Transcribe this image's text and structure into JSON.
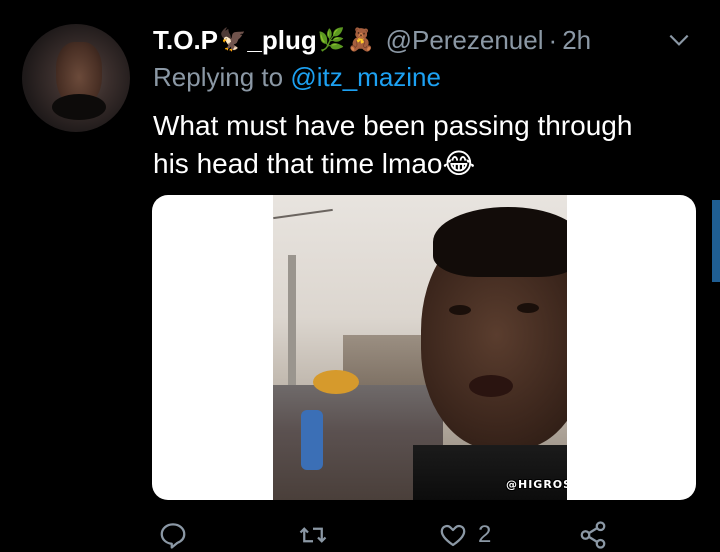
{
  "tweet": {
    "display_name": "T.O.P",
    "display_name_suffix": "_plug",
    "name_emojis": [
      "🦅",
      "🌿",
      "🧸"
    ],
    "handle": "@Perezenuel",
    "separator": "·",
    "time": "2h",
    "reply_prefix": "Replying to",
    "reply_to": "@itz_mazine",
    "text_lines": [
      "What must have been passing through",
      "his head that time lmao"
    ],
    "text_emoji": "😂",
    "media": {
      "watermark": "@HIGROSAMANI"
    },
    "actions": {
      "reply_icon": "reply-icon",
      "retweet_icon": "retweet-icon",
      "like_icon": "heart-icon",
      "like_count": "2",
      "share_icon": "share-icon"
    }
  },
  "colors": {
    "background": "#000000",
    "text": "#ffffff",
    "muted": "#8b98a5",
    "link": "#1da1f2"
  }
}
